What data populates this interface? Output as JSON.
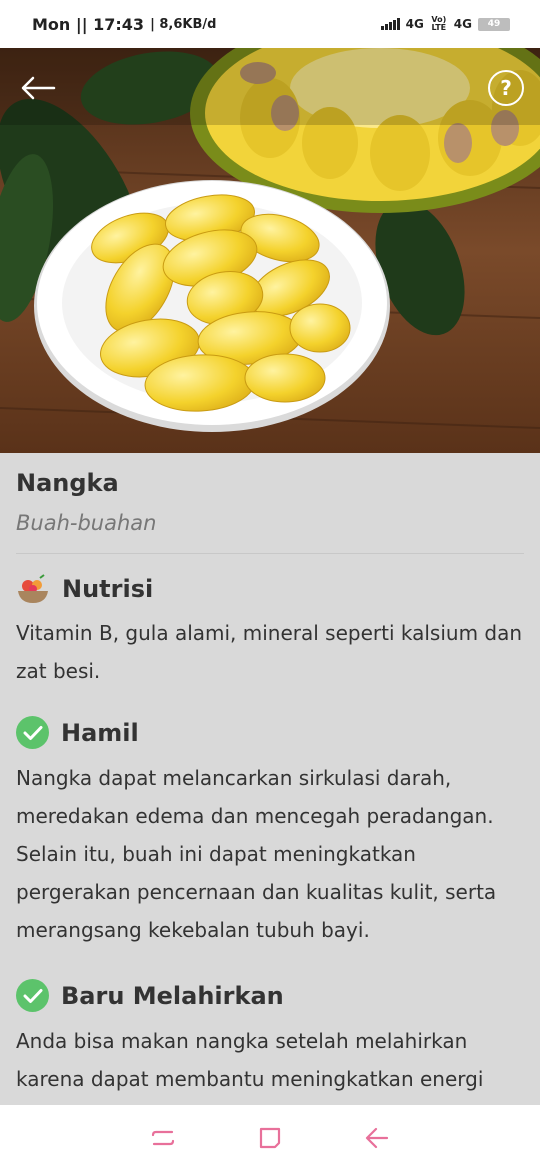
{
  "status_bar": {
    "time": "Mon || 17:43",
    "speed": "| 8,6KB/d",
    "network_1": "4G",
    "volte": "Vo) LTE",
    "network_2": "4G",
    "battery": "49"
  },
  "food": {
    "name": "Nangka",
    "category": "Buah-buahan"
  },
  "sections": {
    "nutrition": {
      "title": "Nutrisi",
      "text": "Vitamin B, gula alami, mineral seperti kalsium dan zat besi."
    },
    "pregnant": {
      "title": "Hamil",
      "text": "Nangka dapat melancarkan sirkulasi darah, meredakan edema dan mencegah peradangan. Selain itu, buah ini dapat meningkatkan pergerakan pencernaan dan kualitas kulit, serta merangsang kekebalan tubuh bayi."
    },
    "postpartum": {
      "title": "Baru Melahirkan",
      "text": "Anda bisa makan nangka setelah melahirkan karena dapat membantu meningkatkan energi"
    }
  },
  "help_label": "?",
  "colors": {
    "accent_nav": "#e8709a",
    "check_green": "#5cc36b",
    "content_bg": "#d9d9d9"
  }
}
